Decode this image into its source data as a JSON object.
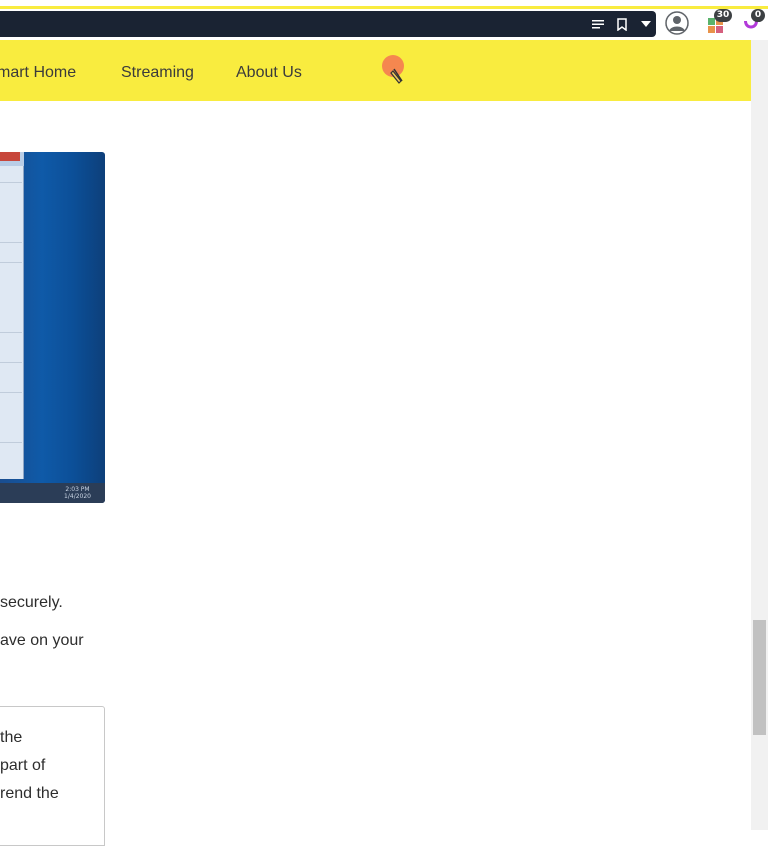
{
  "browser": {
    "extension_badge_1": "30",
    "extension_badge_2": "0",
    "colors": {
      "toolbar_bg": "#1a2333",
      "accent_yellow": "#f9ec3f"
    }
  },
  "nav": {
    "items": [
      {
        "label": "mart Home"
      },
      {
        "label": "Streaming"
      },
      {
        "label": "About Us"
      }
    ],
    "search_icon": "search-icon"
  },
  "article": {
    "screenshot": {
      "taskbar_time": "2:03 PM",
      "taskbar_date": "1/4/2020"
    },
    "paragraph_1": "securely.",
    "paragraph_2": "ave on your",
    "note_lines": [
      "the",
      "part of",
      "rend the"
    ]
  }
}
